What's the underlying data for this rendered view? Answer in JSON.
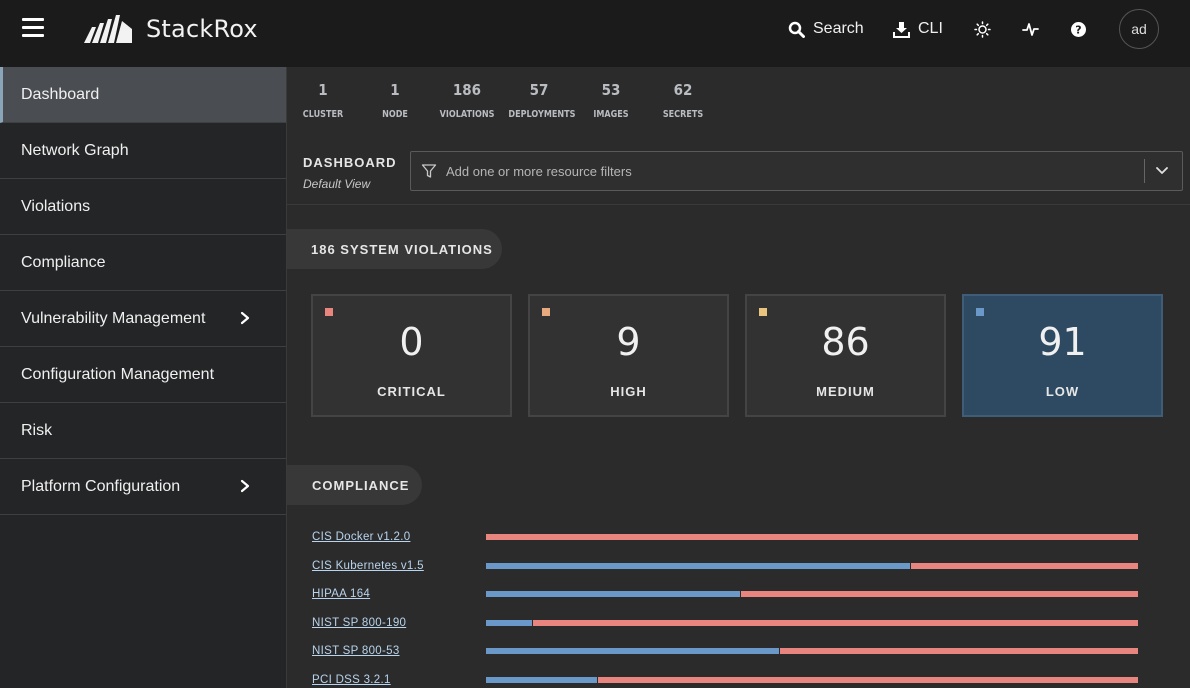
{
  "header": {
    "app_name": "StackRox",
    "search_label": "Search",
    "cli_label": "CLI",
    "avatar_initials": "ad",
    "icons": [
      "hamburger-menu-icon",
      "search-icon",
      "download-icon",
      "sun-icon",
      "pulse-icon",
      "help-icon"
    ]
  },
  "sidebar": {
    "items": [
      {
        "label": "Dashboard",
        "active": true,
        "has_submenu": false
      },
      {
        "label": "Network Graph",
        "active": false,
        "has_submenu": false
      },
      {
        "label": "Violations",
        "active": false,
        "has_submenu": false
      },
      {
        "label": "Compliance",
        "active": false,
        "has_submenu": false
      },
      {
        "label": "Vulnerability Management",
        "active": false,
        "has_submenu": true
      },
      {
        "label": "Configuration Management",
        "active": false,
        "has_submenu": false
      },
      {
        "label": "Risk",
        "active": false,
        "has_submenu": false
      },
      {
        "label": "Platform Configuration",
        "active": false,
        "has_submenu": true
      }
    ]
  },
  "summary": [
    {
      "count": "1",
      "label": "CLUSTER"
    },
    {
      "count": "1",
      "label": "NODE"
    },
    {
      "count": "186",
      "label": "VIOLATIONS"
    },
    {
      "count": "57",
      "label": "DEPLOYMENTS"
    },
    {
      "count": "53",
      "label": "IMAGES"
    },
    {
      "count": "62",
      "label": "SECRETS"
    }
  ],
  "filterbar": {
    "title": "DASHBOARD",
    "subtitle": "Default View",
    "placeholder": "Add one or more resource filters"
  },
  "violations": {
    "heading": "186 SYSTEM VIOLATIONS",
    "severities": [
      {
        "count": "0",
        "label": "CRITICAL",
        "color": "#e8857e"
      },
      {
        "count": "9",
        "label": "HIGH",
        "color": "#e8a97e"
      },
      {
        "count": "86",
        "label": "MEDIUM",
        "color": "#e8c47e"
      },
      {
        "count": "91",
        "label": "LOW",
        "color": "#6a98c8"
      }
    ]
  },
  "compliance": {
    "heading": "COMPLIANCE",
    "pass_color": "#6a98c8",
    "fail_color": "#e8857e",
    "standards": [
      {
        "name": "CIS Docker v1.2.0",
        "pass_fraction": 0.0
      },
      {
        "name": "CIS Kubernetes v1.5",
        "pass_fraction": 0.65
      },
      {
        "name": "HIPAA 164",
        "pass_fraction": 0.39
      },
      {
        "name": "NIST SP 800-190",
        "pass_fraction": 0.07
      },
      {
        "name": "NIST SP 800-53",
        "pass_fraction": 0.45
      },
      {
        "name": "PCI DSS 3.2.1",
        "pass_fraction": 0.17
      }
    ]
  }
}
